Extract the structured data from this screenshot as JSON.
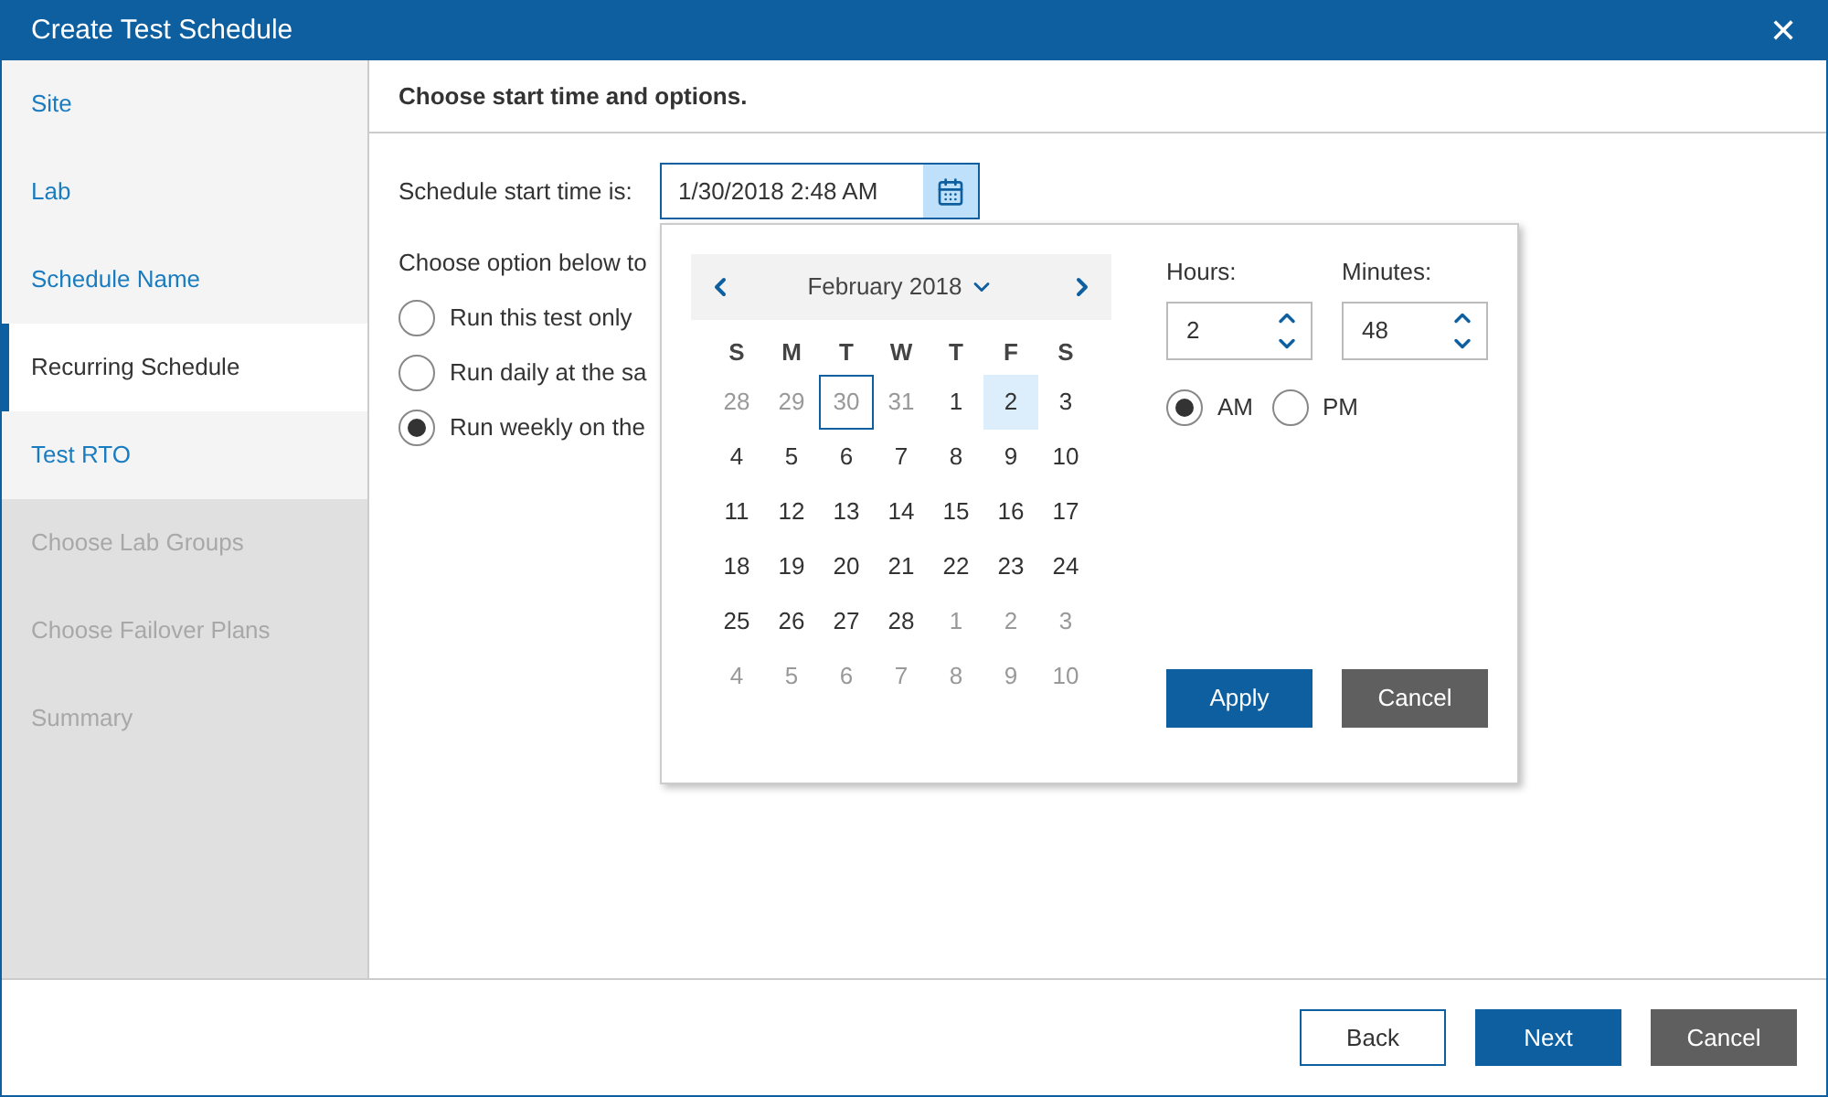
{
  "window": {
    "title": "Create Test Schedule",
    "close": "✕"
  },
  "sidebar": {
    "items": [
      {
        "label": "Site",
        "disabled": false,
        "selected": false
      },
      {
        "label": "Lab",
        "disabled": false,
        "selected": false
      },
      {
        "label": "Schedule Name",
        "disabled": false,
        "selected": false
      },
      {
        "label": "Recurring Schedule",
        "disabled": false,
        "selected": true
      },
      {
        "label": "Test RTO",
        "disabled": false,
        "selected": false
      },
      {
        "label": "Choose Lab Groups",
        "disabled": true,
        "selected": false
      },
      {
        "label": "Choose Failover Plans",
        "disabled": true,
        "selected": false
      },
      {
        "label": "Summary",
        "disabled": true,
        "selected": false
      }
    ]
  },
  "header": "Choose start time and options.",
  "start_time": {
    "label": "Schedule start time is:",
    "value": "1/30/2018 2:48 AM"
  },
  "options_intro": "Choose option below to",
  "options": [
    {
      "label": "Run this test only",
      "selected": false
    },
    {
      "label": "Run daily at the sa",
      "selected": false
    },
    {
      "label": "Run weekly on the",
      "selected": true
    }
  ],
  "picker": {
    "month": "February 2018",
    "weekdays": [
      "S",
      "M",
      "T",
      "W",
      "T",
      "F",
      "S"
    ],
    "days": [
      {
        "day": "28",
        "muted": true,
        "today": false,
        "selected": false
      },
      {
        "day": "29",
        "muted": true,
        "today": false,
        "selected": false
      },
      {
        "day": "30",
        "muted": true,
        "today": true,
        "selected": false
      },
      {
        "day": "31",
        "muted": true,
        "today": false,
        "selected": false
      },
      {
        "day": "1",
        "muted": false,
        "today": false,
        "selected": false
      },
      {
        "day": "2",
        "muted": false,
        "today": false,
        "selected": true
      },
      {
        "day": "3",
        "muted": false,
        "today": false,
        "selected": false
      },
      {
        "day": "4",
        "muted": false,
        "today": false,
        "selected": false
      },
      {
        "day": "5",
        "muted": false,
        "today": false,
        "selected": false
      },
      {
        "day": "6",
        "muted": false,
        "today": false,
        "selected": false
      },
      {
        "day": "7",
        "muted": false,
        "today": false,
        "selected": false
      },
      {
        "day": "8",
        "muted": false,
        "today": false,
        "selected": false
      },
      {
        "day": "9",
        "muted": false,
        "today": false,
        "selected": false
      },
      {
        "day": "10",
        "muted": false,
        "today": false,
        "selected": false
      },
      {
        "day": "11",
        "muted": false,
        "today": false,
        "selected": false
      },
      {
        "day": "12",
        "muted": false,
        "today": false,
        "selected": false
      },
      {
        "day": "13",
        "muted": false,
        "today": false,
        "selected": false
      },
      {
        "day": "14",
        "muted": false,
        "today": false,
        "selected": false
      },
      {
        "day": "15",
        "muted": false,
        "today": false,
        "selected": false
      },
      {
        "day": "16",
        "muted": false,
        "today": false,
        "selected": false
      },
      {
        "day": "17",
        "muted": false,
        "today": false,
        "selected": false
      },
      {
        "day": "18",
        "muted": false,
        "today": false,
        "selected": false
      },
      {
        "day": "19",
        "muted": false,
        "today": false,
        "selected": false
      },
      {
        "day": "20",
        "muted": false,
        "today": false,
        "selected": false
      },
      {
        "day": "21",
        "muted": false,
        "today": false,
        "selected": false
      },
      {
        "day": "22",
        "muted": false,
        "today": false,
        "selected": false
      },
      {
        "day": "23",
        "muted": false,
        "today": false,
        "selected": false
      },
      {
        "day": "24",
        "muted": false,
        "today": false,
        "selected": false
      },
      {
        "day": "25",
        "muted": false,
        "today": false,
        "selected": false
      },
      {
        "day": "26",
        "muted": false,
        "today": false,
        "selected": false
      },
      {
        "day": "27",
        "muted": false,
        "today": false,
        "selected": false
      },
      {
        "day": "28",
        "muted": false,
        "today": false,
        "selected": false
      },
      {
        "day": "1",
        "muted": true,
        "today": false,
        "selected": false
      },
      {
        "day": "2",
        "muted": true,
        "today": false,
        "selected": false
      },
      {
        "day": "3",
        "muted": true,
        "today": false,
        "selected": false
      },
      {
        "day": "4",
        "muted": true,
        "today": false,
        "selected": false
      },
      {
        "day": "5",
        "muted": true,
        "today": false,
        "selected": false
      },
      {
        "day": "6",
        "muted": true,
        "today": false,
        "selected": false
      },
      {
        "day": "7",
        "muted": true,
        "today": false,
        "selected": false
      },
      {
        "day": "8",
        "muted": true,
        "today": false,
        "selected": false
      },
      {
        "day": "9",
        "muted": true,
        "today": false,
        "selected": false
      },
      {
        "day": "10",
        "muted": true,
        "today": false,
        "selected": false
      }
    ],
    "hours": {
      "label": "Hours:",
      "value": "2"
    },
    "minutes": {
      "label": "Minutes:",
      "value": "48"
    },
    "meridiem": [
      {
        "label": "AM",
        "selected": true
      },
      {
        "label": "PM",
        "selected": false
      }
    ],
    "buttons": [
      {
        "label": "Apply",
        "kind": "primary"
      },
      {
        "label": "Cancel",
        "kind": "secondary"
      }
    ]
  },
  "footer": {
    "buttons": [
      {
        "label": "Back",
        "kind": "outline"
      },
      {
        "label": "Next",
        "kind": "primary"
      },
      {
        "label": "Cancel",
        "kind": "secondary"
      }
    ]
  }
}
